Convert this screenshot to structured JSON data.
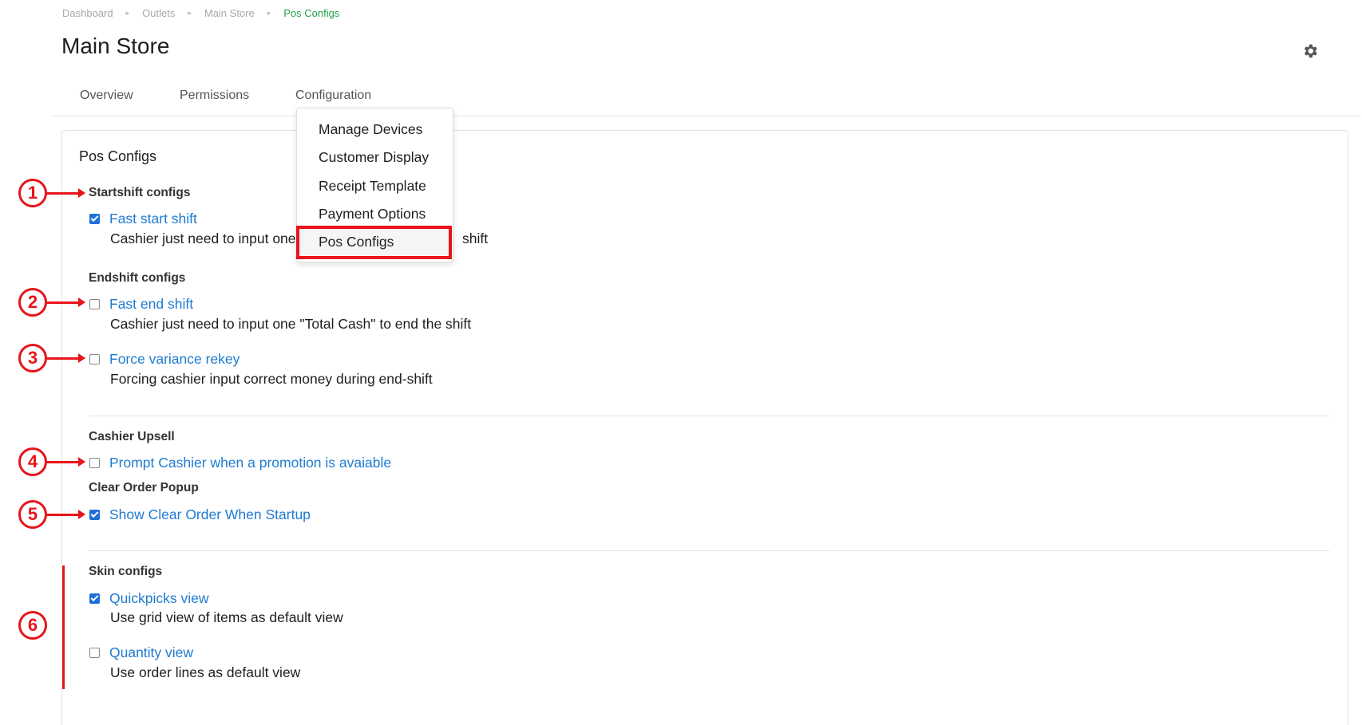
{
  "breadcrumb": [
    "Dashboard",
    "Outlets",
    "Main Store",
    "Pos Configs"
  ],
  "page_title": "Main Store",
  "tabs": [
    "Overview",
    "Permissions",
    "Configuration"
  ],
  "dropdown": {
    "items": [
      "Manage Devices",
      "Customer Display",
      "Receipt Template",
      "Payment Options",
      "Pos Configs"
    ],
    "selected": "Pos Configs"
  },
  "card_title": "Pos Configs",
  "groups": {
    "startshift": {
      "title": "Startshift configs",
      "fast_start": {
        "label": "Fast start shift",
        "checked": true,
        "desc": "Cashier just need to input one",
        "desc_tail": "shift"
      }
    },
    "endshift": {
      "title": "Endshift configs",
      "fast_end": {
        "label": "Fast end shift",
        "checked": false,
        "desc": "Cashier just need to input one \"Total Cash\" to end the shift"
      },
      "force_variance": {
        "label": "Force variance rekey",
        "checked": false,
        "desc": "Forcing cashier input correct money during end-shift"
      }
    },
    "upsell": {
      "title": "Cashier Upsell",
      "prompt": {
        "label": "Prompt Cashier when a promotion is avaiable",
        "checked": false
      }
    },
    "clear_order": {
      "title": "Clear Order Popup",
      "show": {
        "label": "Show Clear Order When Startup",
        "checked": true
      }
    },
    "skin": {
      "title": "Skin configs",
      "quickpicks": {
        "label": "Quickpicks view",
        "checked": true,
        "desc": "Use grid view of items as default view"
      },
      "quantity": {
        "label": "Quantity view",
        "checked": false,
        "desc": "Use order lines as default view"
      }
    }
  },
  "annotations": [
    "1",
    "2",
    "3",
    "4",
    "5",
    "6"
  ],
  "colors": {
    "accent": "#1f7ad1",
    "breadcrumb_active": "#21a04a",
    "annotation": "#e8141a",
    "checkbox": "#1f6fd6"
  },
  "icons": {
    "settings": "gear-icon"
  }
}
